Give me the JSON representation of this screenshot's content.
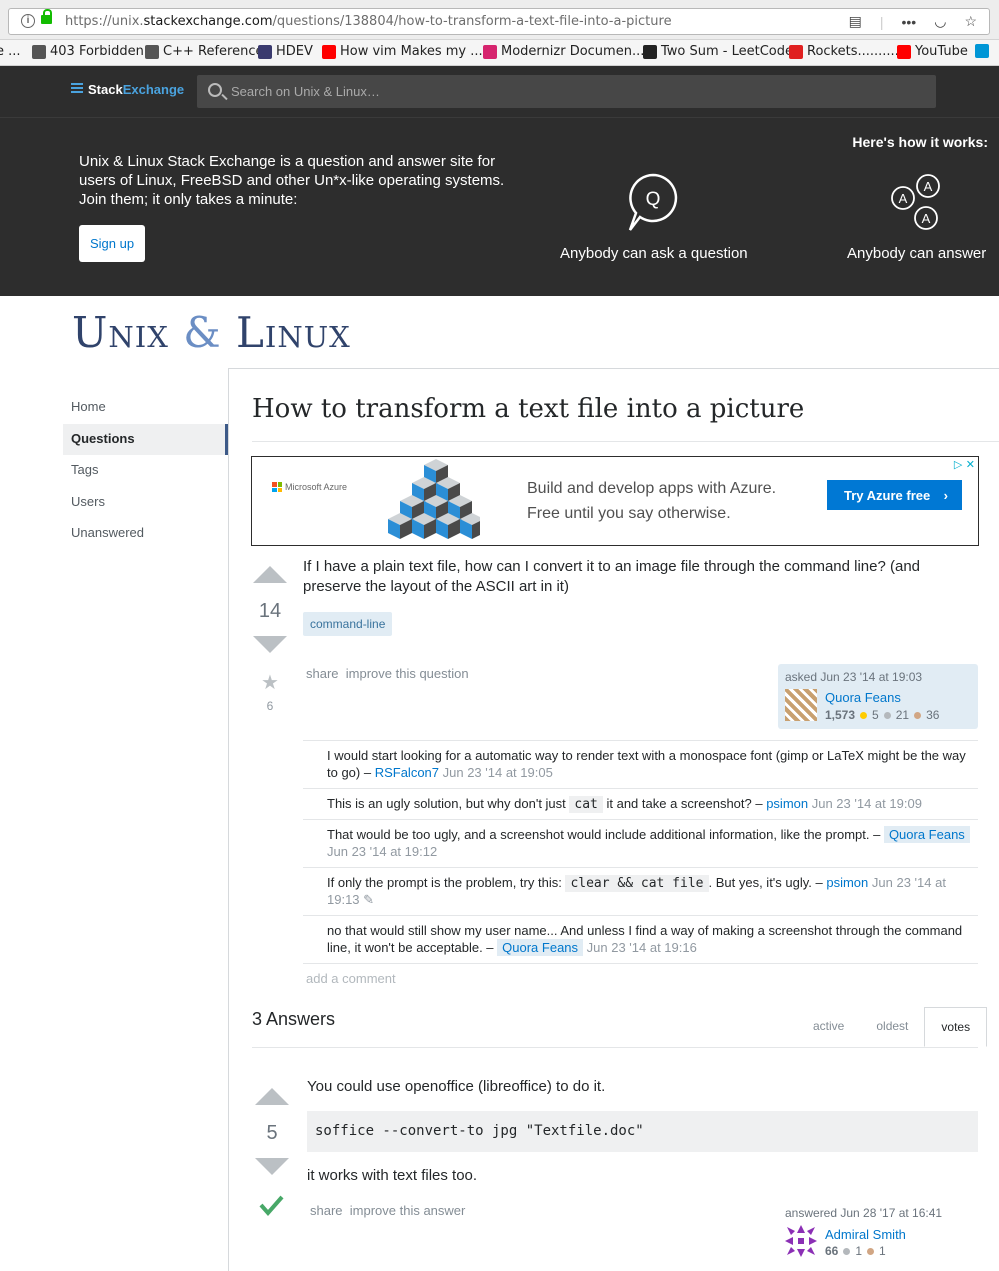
{
  "browser": {
    "url_prefix": "https://unix.",
    "url_host": "stackexchange.com",
    "url_path": "/questions/138804/how-to-transform-a-text-file-into-a-picture",
    "bookmarks": [
      {
        "label": "e ...",
        "icon": "truncated-icon",
        "color": "#888888"
      },
      {
        "label": "403 Forbidden",
        "icon": "globe-icon",
        "color": "#555555"
      },
      {
        "label": "C++ Reference",
        "icon": "globe-icon",
        "color": "#555555"
      },
      {
        "label": "HDEV",
        "icon": "app-icon",
        "color": "#3a3a6e"
      },
      {
        "label": "How vim Makes my ...",
        "icon": "youtube-icon",
        "color": "#ff0000"
      },
      {
        "label": "Modernizr Documen...",
        "icon": "modernizr-icon",
        "color": "#d6246e"
      },
      {
        "label": "Two Sum - LeetCode",
        "icon": "leetcode-icon",
        "color": "#222222"
      },
      {
        "label": "Rockets...........",
        "icon": "bookmark-icon",
        "color": "#e02020"
      },
      {
        "label": "YouTube",
        "icon": "youtube-icon",
        "color": "#ff0000"
      },
      {
        "label": "",
        "icon": "hp-icon",
        "color": "#0096d6"
      }
    ]
  },
  "se_header": {
    "logo_stack": "Stack",
    "logo_exchange": "Exchange",
    "search_placeholder": "Search on Unix & Linux…"
  },
  "hero": {
    "intro": "Unix & Linux Stack Exchange is a question and answer site for users of Linux, FreeBSD and other Un*x-like operating systems. Join them; it only takes a minute:",
    "signup_label": "Sign up",
    "how_title": "Here's how it works:",
    "ask_label": "Anybody can ask a question",
    "answer_label": "Anybody can answer"
  },
  "site": {
    "logo_left": "Unix",
    "logo_amp": "&",
    "logo_right": "Linux"
  },
  "nav": [
    "Home",
    "Questions",
    "Tags",
    "Users",
    "Unanswered"
  ],
  "question": {
    "title": "How to transform a text file into a picture",
    "body": "If I have a plain text file, how can I convert it to an image file through the command line? (and preserve the layout of the ASCII art in it)",
    "votes": "14",
    "favorites": "6",
    "tag": "command-line",
    "share_label": "share",
    "improve_label": "improve this question",
    "asked": "asked Jun 23 '14 at 19:03",
    "user": "Quora Feans",
    "rep": "1,573",
    "gold": "5",
    "silver": "21",
    "bronze": "36"
  },
  "ad": {
    "brand": "Microsoft Azure",
    "line1": "Build and develop apps with Azure.",
    "line2": "Free until you say otherwise.",
    "button": "Try Azure free",
    "close": "▷ ✕"
  },
  "comments": [
    {
      "pre": "I would start looking for a automatic way to render text with a monospace font (gimp or LaTeX might be the way to go) – ",
      "user": "RSFalcon7",
      "date": " Jun 23 '14 at 19:05"
    },
    {
      "pre": "This is an ugly solution, but why don't just ",
      "code": "cat",
      "post": " it and take a screenshot? – ",
      "user": "psimon",
      "date": " Jun 23 '14 at 19:09"
    },
    {
      "pre": "That would be too ugly, and a screenshot would include additional information, like the prompt. – ",
      "user": "Quora Feans",
      "date": " Jun 23 '14 at 19:12"
    },
    {
      "pre": "If only the prompt is the problem, try this: ",
      "code": "clear && cat file",
      "post": ". But yes, it's ugly. – ",
      "user": "psimon",
      "date": " Jun 23 '14 at 19:13"
    },
    {
      "pre": "no that would still show my user name... And unless I find a way of making a screenshot through the command line, it won't be acceptable. – ",
      "user": "Quora Feans",
      "date": " Jun 23 '14 at 19:16"
    }
  ],
  "add_comment": "add a comment",
  "answers": {
    "header": "3 Answers",
    "tabs": [
      "active",
      "oldest",
      "votes"
    ],
    "first": {
      "votes": "5",
      "body1": "You could use openoffice (libreoffice) to do it.",
      "code": "soffice --convert-to jpg \"Textfile.doc\"",
      "body2": "it works with text files too.",
      "share_label": "share",
      "improve_label": "improve this answer",
      "answered": "answered Jun 28 '17 at 16:41",
      "user": "Admiral Smith",
      "rep": "66",
      "silver": "1",
      "bronze": "1"
    }
  }
}
